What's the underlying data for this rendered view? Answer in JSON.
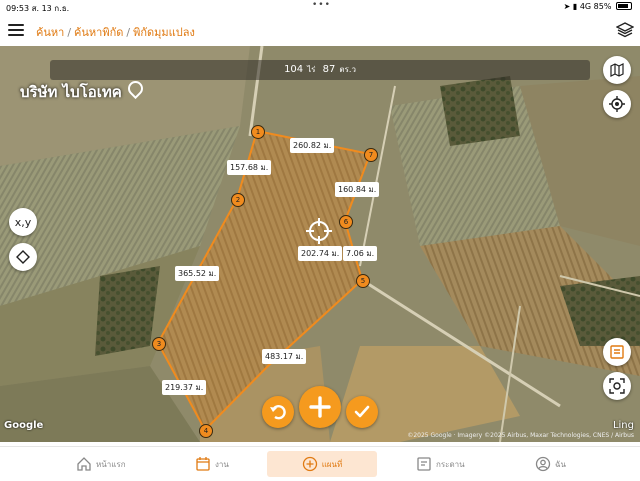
{
  "status": {
    "time": "09:53",
    "date": "ส. 13 ก.ธ.",
    "dots": "•••",
    "network": "4G",
    "battery": "85%"
  },
  "breadcrumb": [
    "ค้นหา",
    "ค้นหาพิกัด",
    "พิกัดมุมแปลง"
  ],
  "area": {
    "rai": "104",
    "rai_unit": "ไร่",
    "wa": "87",
    "wa_unit": "ตร.ว"
  },
  "company": "บริษัท ไบโอเทค",
  "side_buttons": {
    "xy": "x,y"
  },
  "vertices": [
    "1",
    "2",
    "3",
    "4",
    "5",
    "6",
    "7"
  ],
  "edges": [
    "260.82 ม.",
    "157.68 ม.",
    "160.84 ม.",
    "365.52 ม.",
    "202.74 ม.",
    "7.06 ม.",
    "483.17 ม.",
    "219.37 ม."
  ],
  "map_credits": {
    "google": "Google",
    "ling": "Ling",
    "attribution": "©2025 Google · Imagery ©2025 Airbus, Maxar Technologies, CNES / Airbus"
  },
  "tabs": [
    {
      "label": "หน้าแรก",
      "icon": "home-icon"
    },
    {
      "label": "งาน",
      "icon": "calendar-icon"
    },
    {
      "label": "แผนที่",
      "icon": "plus-circle-icon",
      "active": true
    },
    {
      "label": "กระดาน",
      "icon": "board-icon"
    },
    {
      "label": "ฉัน",
      "icon": "user-icon"
    }
  ],
  "colors": {
    "accent": "#f59a1e",
    "polygon": "#f08b1e"
  }
}
